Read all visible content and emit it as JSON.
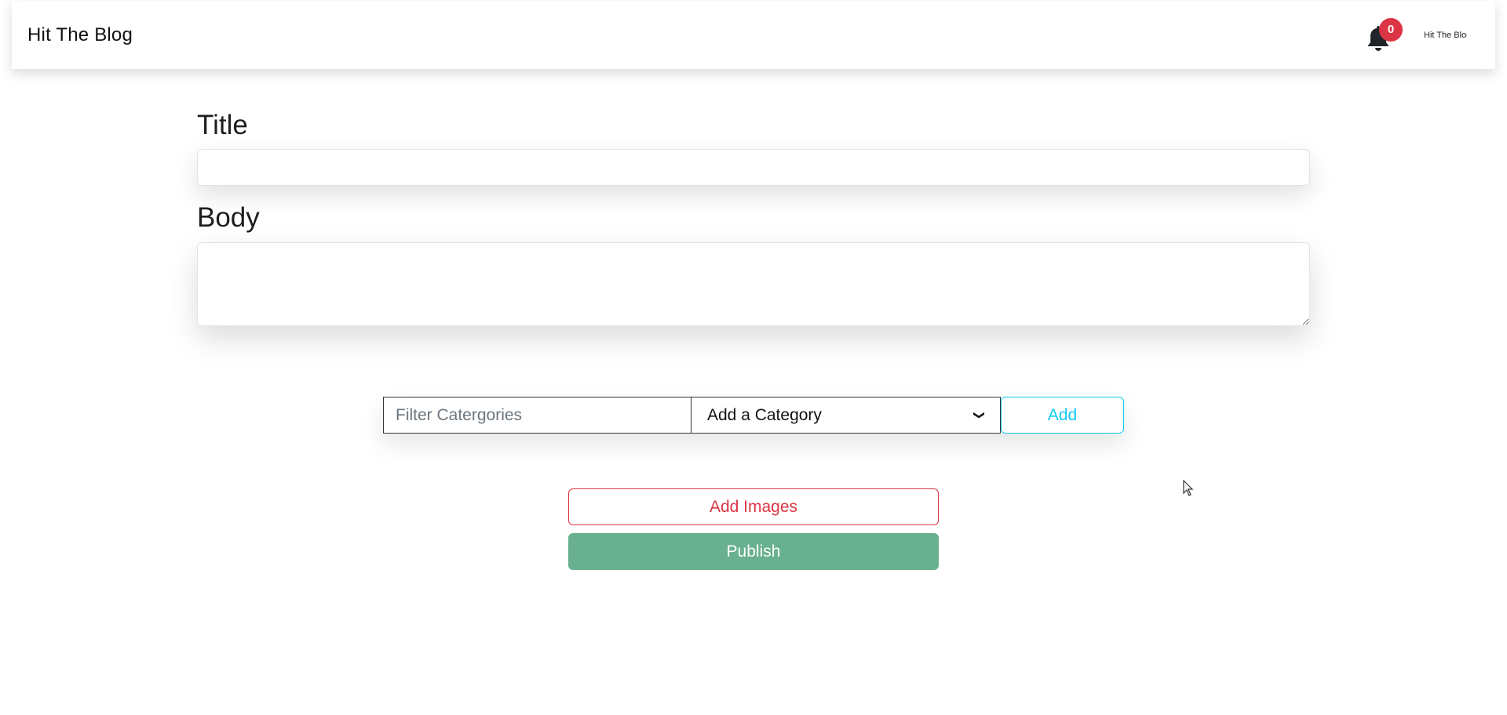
{
  "navbar": {
    "brand": "Hit The Blog",
    "notifications": {
      "icon": "bell-icon",
      "count": "0",
      "badge_color": "#dc3545"
    },
    "logo_text": "Hit The Blog"
  },
  "form": {
    "title_label": "Title",
    "title_value": "",
    "body_label": "Body",
    "body_value": ""
  },
  "categories": {
    "filter_placeholder": "Filter Catergories",
    "select_value": "Add a Category",
    "add_label": "Add",
    "add_color": "#0dcaf0"
  },
  "actions": {
    "add_images_label": "Add Images",
    "add_images_color": "#dc3545",
    "publish_label": "Publish",
    "publish_color": "#68b08f"
  }
}
